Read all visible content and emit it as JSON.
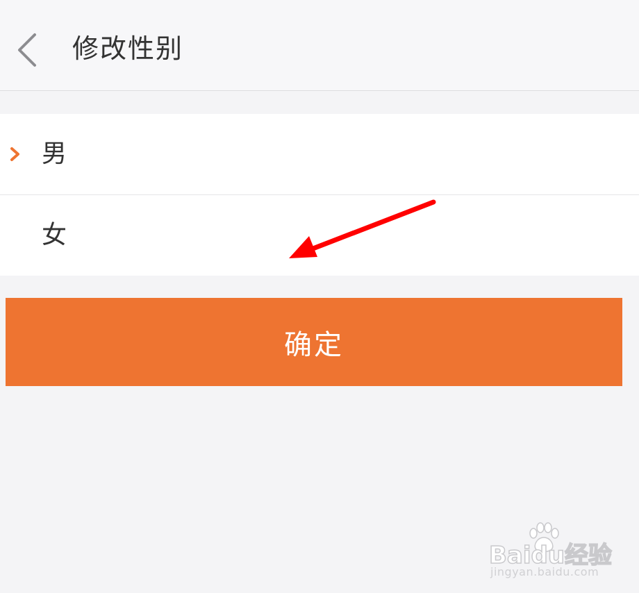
{
  "header": {
    "back_icon": "chevron-left-icon",
    "title": "修改性别"
  },
  "options": [
    {
      "label": "男",
      "selected": true,
      "marker_icon": "chevron-right-icon"
    },
    {
      "label": "女",
      "selected": false
    }
  ],
  "confirm_button": {
    "label": "确定"
  },
  "annotation": {
    "icon": "red-arrow-icon",
    "color": "#ff0000"
  },
  "watermark": {
    "brand": "Baidu经验",
    "url": "jingyan.baidu.com",
    "icon": "baidu-paw-icon"
  },
  "colors": {
    "accent": "#ee7431",
    "header_bg": "#f7f7f9",
    "page_bg": "#f4f4f6",
    "text": "#333333"
  }
}
